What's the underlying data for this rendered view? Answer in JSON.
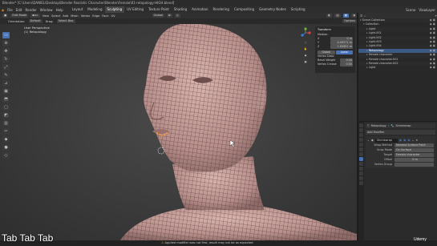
{
  "window": {
    "title": "Blender* [C:\\Users\\DANIEL\\Desktop\\Blender Realistic Character\\Blender\\Female\\01-retopology-HIGH.blend]"
  },
  "menu": {
    "items": [
      "File",
      "Edit",
      "Render",
      "Window",
      "Help"
    ],
    "workspaces": [
      "Layout",
      "Modeling",
      "Sculpting",
      "UV Editing",
      "Texture Paint",
      "Shading",
      "Animation",
      "Rendering",
      "Compositing",
      "Geometry Nodes",
      "Scripting"
    ],
    "active_workspace": "Sculpting",
    "scene": "Scene",
    "view_layer": "ViewLayer"
  },
  "header": {
    "mode": "Edit Mode",
    "view_items": [
      "View",
      "Select",
      "Add",
      "Mesh",
      "Vertex",
      "Edge",
      "Face",
      "UV"
    ],
    "orientation": "Global",
    "orientation_label": "Orientation:",
    "orientation_value": "Default",
    "drag_label": "Drag:",
    "drag_value": "Select Box",
    "options_label": "Options"
  },
  "viewport": {
    "overlay_line1": "User Perspective",
    "overlay_line2": "(1) Retopology",
    "tools": [
      "select-icon",
      "cursor-icon",
      "move-icon",
      "rotate-icon",
      "scale-icon",
      "transform-icon",
      "annotate-icon",
      "measure-icon",
      "add-cube-icon",
      "extrude-icon",
      "inset-icon",
      "bevel-icon",
      "loopcut-icon",
      "knife-icon",
      "polybuild-icon",
      "spin-icon",
      "smooth-icon",
      "edge-slide-icon",
      "shrink-icon",
      "shear-icon",
      "rip-icon"
    ]
  },
  "npanel": {
    "section": "Transform",
    "median_label": "Median:",
    "rows": [
      {
        "axis": "X",
        "value": "0 m"
      },
      {
        "axis": "Y",
        "value": "-0.09271 m"
      },
      {
        "axis": "Z",
        "value": "1.63451 m"
      }
    ],
    "space_buttons": [
      "Global",
      "Local"
    ],
    "vertex_data_label": "Vertex Data:",
    "bevel_weight_label": "Bevel Weight",
    "bevel_weight_value": "0.00",
    "crease_label": "Vertex Crease",
    "crease_value": "0.00",
    "tabs": [
      "Item",
      "Tool",
      "View"
    ]
  },
  "outliner": {
    "header": "Scene Collection",
    "rows": [
      {
        "label": "Scene Collection",
        "indent": 0,
        "selected": false
      },
      {
        "label": "Collection",
        "indent": 1,
        "selected": false
      },
      {
        "label": "Light",
        "indent": 2,
        "selected": false
      },
      {
        "label": "Light.001",
        "indent": 2,
        "selected": false
      },
      {
        "label": "Light.002",
        "indent": 2,
        "selected": false
      },
      {
        "label": "Light.003",
        "indent": 2,
        "selected": false
      },
      {
        "label": "Light.004",
        "indent": 2,
        "selected": false
      },
      {
        "label": "Retopology",
        "indent": 2,
        "selected": true
      },
      {
        "label": "Female character",
        "indent": 2,
        "selected": false
      },
      {
        "label": "Female character.001",
        "indent": 2,
        "selected": false
      },
      {
        "label": "Female character.002",
        "indent": 2,
        "selected": false
      },
      {
        "label": "Light",
        "indent": 2,
        "selected": false
      }
    ]
  },
  "properties": {
    "breadcrumb_object": "Retopology",
    "breadcrumb_modifier": "Shrinkwrap",
    "add_modifier": "Add Modifier",
    "modifier_name": "Shrinkwrap",
    "fields": [
      {
        "key": "Wrap Method",
        "value": "Nearest Surface Point"
      },
      {
        "key": "Snap Mode",
        "value": "On Surface"
      },
      {
        "key": "Target",
        "value": "Female character"
      },
      {
        "key": "Offset",
        "value": "0 m"
      },
      {
        "key": "Vertex Group",
        "value": ""
      }
    ]
  },
  "status": {
    "text": "Applied modifier was not first, result may not be as expected"
  },
  "caption": "Tab Tab Tab",
  "watermark": "Udemy",
  "colors": {
    "accent": "#4772b3",
    "mesh_fill": "#cfa6a2",
    "wire": "#3a2a2a",
    "selected_vertex": "#ff9a2e"
  }
}
